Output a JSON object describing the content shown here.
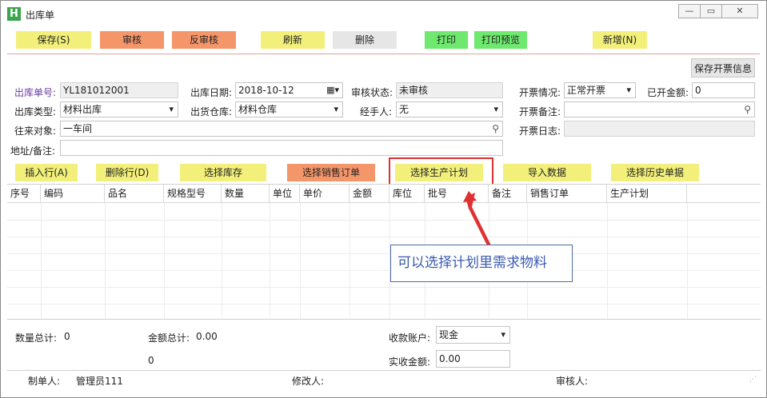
{
  "window": {
    "title": "出库单",
    "icon_letter": "H"
  },
  "toolbar": {
    "save": "保存(S)",
    "audit": "审核",
    "unaudit": "反审核",
    "refresh": "刷新",
    "delete": "删除",
    "print": "打印",
    "print_preview": "打印预览",
    "new": "新增(N)"
  },
  "invoice_button": "保存开票信息",
  "form": {
    "order_no_label": "出库单号:",
    "order_no": "YL181012001",
    "out_date_label": "出库日期:",
    "out_date": "2018-10-12",
    "audit_status_label": "审核状态:",
    "audit_status": "未审核",
    "invoice_status_label": "开票情况:",
    "invoice_status": "正常开票",
    "invoiced_amount_label": "已开金额:",
    "invoiced_amount": "0",
    "out_type_label": "出库类型:",
    "out_type": "材料出库",
    "warehouse_label": "出货仓库:",
    "warehouse": "材料仓库",
    "handler_label": "经手人:",
    "handler": "无",
    "invoice_note_label": "开票备注:",
    "invoice_note": "",
    "partner_label": "往来对象:",
    "partner": "一车间",
    "invoice_date_label": "开票日志:",
    "invoice_date": "",
    "address_label": "地址/备注:",
    "address": ""
  },
  "actions": {
    "insert_row": "插入行(A)",
    "delete_row": "删除行(D)",
    "select_stock": "选择库存",
    "select_sales_order": "选择销售订单",
    "select_production_plan": "选择生产计划",
    "import_data": "导入数据",
    "select_history": "选择历史单据"
  },
  "grid": {
    "columns": [
      "序号",
      "编码",
      "品名",
      "规格型号",
      "数量",
      "单位",
      "单价",
      "金额",
      "库位",
      "批号",
      "备注",
      "销售订单",
      "生产计划"
    ],
    "rows": []
  },
  "annotation": {
    "text": "可以选择计划里需求物料"
  },
  "footer": {
    "qty_total_label": "数量总计:",
    "qty_total": "0",
    "amount_total_label": "金额总计:",
    "amount_total": "0.00",
    "sub_total": "0",
    "account_label": "收款账户:",
    "account": "现金",
    "received_label": "实收金额:",
    "received": "0.00"
  },
  "status": {
    "maker_label": "制单人:",
    "maker": "管理员111",
    "modifier_label": "修改人:",
    "modifier": "",
    "auditor_label": "审核人:",
    "auditor": ""
  },
  "colors": {
    "yellow": "#f2f07a",
    "orange": "#f5956a",
    "green": "#6ee86e",
    "highlight": "#e03030",
    "callout": "#3a5ab0"
  }
}
